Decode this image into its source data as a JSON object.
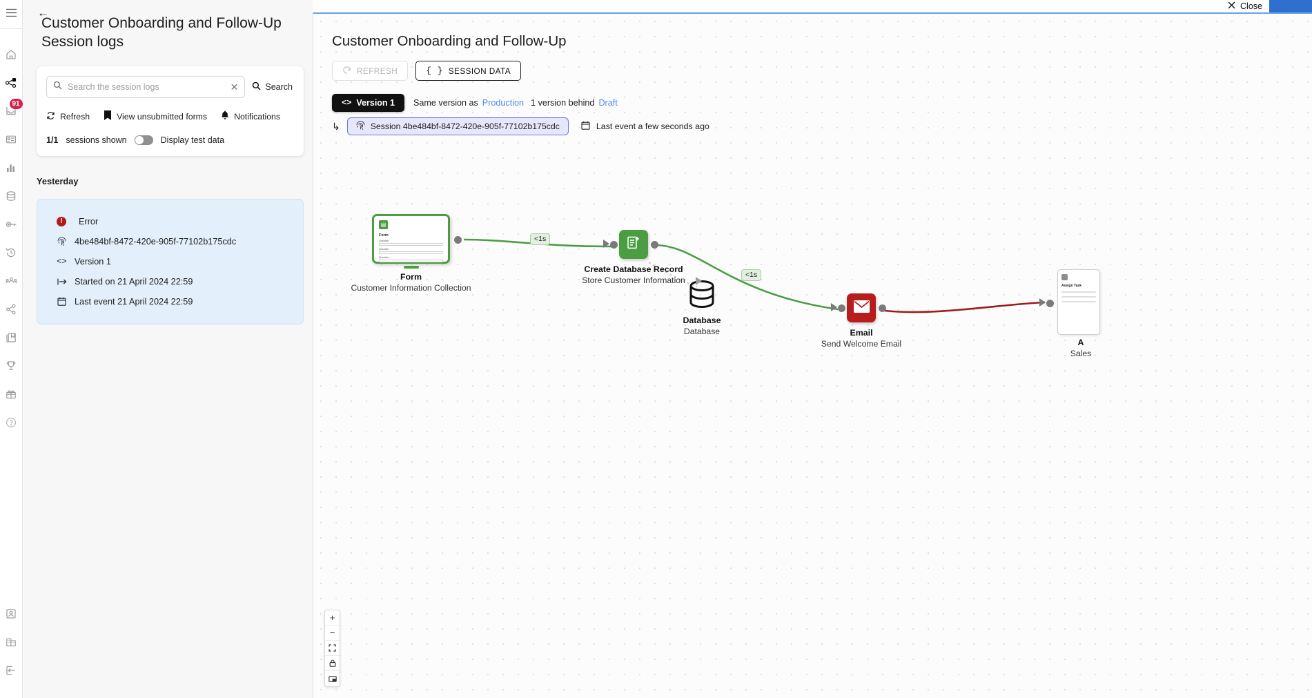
{
  "rail": {
    "menu_icon": "hamburger-icon",
    "items": [
      {
        "icon": "home-icon",
        "name": "home"
      },
      {
        "icon": "sitemap-icon",
        "name": "flows"
      },
      {
        "icon": "inbox-icon",
        "name": "inbox",
        "badge": "91"
      },
      {
        "icon": "forms-icon",
        "name": "forms"
      },
      {
        "icon": "chart-icon",
        "name": "analytics"
      },
      {
        "icon": "database-icon",
        "name": "data"
      },
      {
        "icon": "key-icon",
        "name": "credentials"
      },
      {
        "icon": "history-icon",
        "name": "history"
      },
      {
        "icon": "users-icon",
        "name": "teams"
      },
      {
        "icon": "share-icon",
        "name": "share"
      },
      {
        "icon": "library-icon",
        "name": "library"
      },
      {
        "icon": "trophy-icon",
        "name": "achievements"
      },
      {
        "icon": "gift-icon",
        "name": "rewards"
      },
      {
        "icon": "help-icon",
        "name": "help"
      }
    ],
    "bottom_items": [
      {
        "icon": "user-badge-icon",
        "name": "account"
      },
      {
        "icon": "building-icon",
        "name": "organization"
      },
      {
        "icon": "logout-icon",
        "name": "logout"
      }
    ]
  },
  "logs": {
    "back_label": "←",
    "title": "Customer Onboarding and Follow-Up Session logs",
    "search": {
      "placeholder": "Search the session logs",
      "value": "",
      "clear_label": "✕",
      "button_label": "Search"
    },
    "actions": [
      {
        "label": "Refresh",
        "icon": "refresh-icon"
      },
      {
        "label": "View unsubmitted forms",
        "icon": "book-icon"
      },
      {
        "label": "Notifications",
        "icon": "bell-icon"
      }
    ],
    "count": "1/1",
    "count_label": "sessions shown",
    "toggle_label": "Display test data",
    "toggle_on": false,
    "day_label": "Yesterday",
    "session": {
      "status": "Error",
      "status_icon": "error-icon",
      "id": "4be484bf-8472-420e-905f-77102b175cdc",
      "id_icon": "fingerprint-icon",
      "version": "Version 1",
      "version_icon": "code-icon",
      "started": "Started on 21 April 2024 22:59",
      "started_icon": "start-icon",
      "last_event": "Last event 21 April 2024 22:59",
      "last_event_icon": "calendar-icon"
    }
  },
  "topbar": {
    "close_label": "Close",
    "close_icon": "close-icon"
  },
  "flow": {
    "title": "Customer Onboarding and Follow-Up",
    "refresh_label": "REFRESH",
    "refresh_icon": "refresh-icon",
    "session_data_label": "SESSION DATA",
    "session_data_icon": "code-braces-icon",
    "version_chip": "Version 1",
    "version_chip_icon": "code-icon",
    "version_note_prefix": "Same version as",
    "version_note_link": "Production",
    "version_behind": "1 version behind",
    "version_behind_link": "Draft",
    "session_chip": "Session 4be484bf-8472-420e-905f-77102b175cdc",
    "session_chip_icon": "fingerprint-icon",
    "last_event_text": "Last event a few seconds ago",
    "last_event_icon": "calendar-icon",
    "turn_icon": "turn-arrow-icon",
    "nodes": [
      {
        "id": "form",
        "name": "Form",
        "subtitle": "Customer Information Collection",
        "type": "form-card",
        "color": "#4a9e41",
        "inner_title": "Form",
        "fields": [
          "Question",
          "Question",
          "Question"
        ]
      },
      {
        "id": "create-db-record",
        "name": "Create Database Record",
        "subtitle": "Store Customer Information",
        "type": "square",
        "color": "#4a9e41",
        "icon": "document-plus-icon"
      },
      {
        "id": "database",
        "name": "Database",
        "subtitle": "Database",
        "type": "cylinder",
        "color": "#111111",
        "icon": "database-icon"
      },
      {
        "id": "email",
        "name": "Email",
        "subtitle": "Send Welcome Email",
        "type": "square",
        "color": "#b81d1d",
        "icon": "envelope-icon"
      },
      {
        "id": "assign-task",
        "name": "A",
        "subtitle": "Sales",
        "type": "partial-card",
        "color": "#cfcfcf",
        "inner_title": "Assign Task"
      }
    ],
    "edges": [
      {
        "from": "form",
        "to": "create-db-record",
        "latency": "<1s",
        "color": "#4a9e41"
      },
      {
        "from": "create-db-record",
        "to": "email",
        "latency": "<1s",
        "color": "#4a9e41"
      },
      {
        "from": "create-db-record",
        "to": "database",
        "latency": "",
        "color": "#cfcfcf"
      },
      {
        "from": "email",
        "to": "assign-task",
        "latency": "",
        "color": "#9e1b1b"
      }
    ],
    "zoom_controls": [
      {
        "label": "+",
        "name": "zoom-in"
      },
      {
        "label": "−",
        "name": "zoom-out"
      },
      {
        "label": "⛶",
        "name": "fit-view"
      },
      {
        "label": "🔒",
        "name": "lock-view"
      },
      {
        "label": "▭",
        "name": "minimap"
      }
    ]
  }
}
